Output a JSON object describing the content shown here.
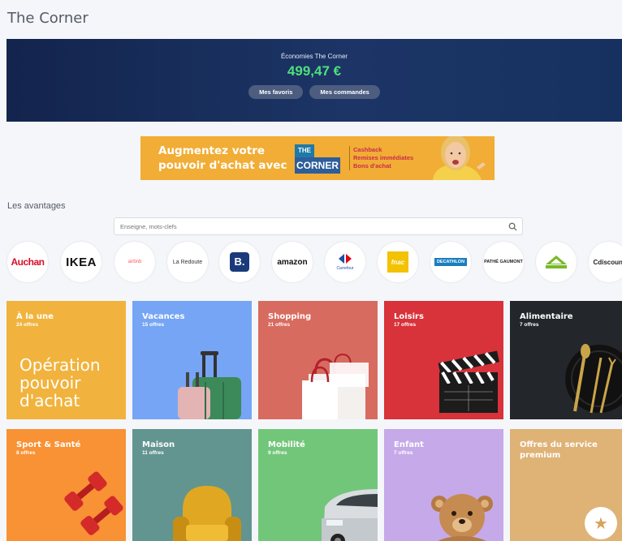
{
  "page": {
    "title": "The Corner"
  },
  "hero": {
    "label": "Économies The Corner",
    "amount": "499,47 €",
    "favorites_label": "Mes favoris",
    "orders_label": "Mes commandes"
  },
  "banner": {
    "line1": "Augmentez votre",
    "line2": "pouvoir d'achat avec",
    "logo_top": "THE",
    "logo_bottom": "CORNER",
    "features": [
      "Cashback",
      "Remises immédiates",
      "Bons d'achat"
    ]
  },
  "advantages": {
    "title": "Les avantages",
    "search_placeholder": "Enseigne, mots-clefs",
    "search_icon": "search-icon"
  },
  "brands": [
    {
      "name": "Auchan",
      "text": "Auchan"
    },
    {
      "name": "IKEA",
      "text": "IKEA"
    },
    {
      "name": "Airbnb",
      "text": "airbnb"
    },
    {
      "name": "La Redoute",
      "text": "La Redoute"
    },
    {
      "name": "Booking",
      "text": "B."
    },
    {
      "name": "Amazon",
      "text": "amazon"
    },
    {
      "name": "Carrefour",
      "text": "Carrefour"
    },
    {
      "name": "Fnac",
      "text": "fnac"
    },
    {
      "name": "Decathlon",
      "text": "DECATHLON"
    },
    {
      "name": "Pathé Gaumont",
      "text": "PATHÉ GAUMONT"
    },
    {
      "name": "Leroy Merlin",
      "text": ""
    },
    {
      "name": "Cdiscount",
      "text": "Cdiscount"
    }
  ],
  "categories": [
    {
      "name": "À la une",
      "count": "24 offres",
      "color": "#f1b33d",
      "promo": [
        "Opération",
        "pouvoir",
        "d'achat"
      ]
    },
    {
      "name": "Vacances",
      "count": "15 offres",
      "color": "#76a5f5"
    },
    {
      "name": "Shopping",
      "count": "21 offres",
      "color": "#d86b5f"
    },
    {
      "name": "Loisirs",
      "count": "17 offres",
      "color": "#d8323a"
    },
    {
      "name": "Alimentaire",
      "count": "7 offres",
      "color": "#23272b"
    },
    {
      "name": "Sport & Santé",
      "count": "8 offres",
      "color": "#f89235"
    },
    {
      "name": "Maison",
      "count": "11 offres",
      "color": "#62958f"
    },
    {
      "name": "Mobilité",
      "count": "9 offres",
      "color": "#72c67a"
    },
    {
      "name": "Enfant",
      "count": "7 offres",
      "color": "#c6a9e8"
    },
    {
      "name": "Offres du service premium",
      "count": "",
      "color": "#dfb276"
    }
  ]
}
